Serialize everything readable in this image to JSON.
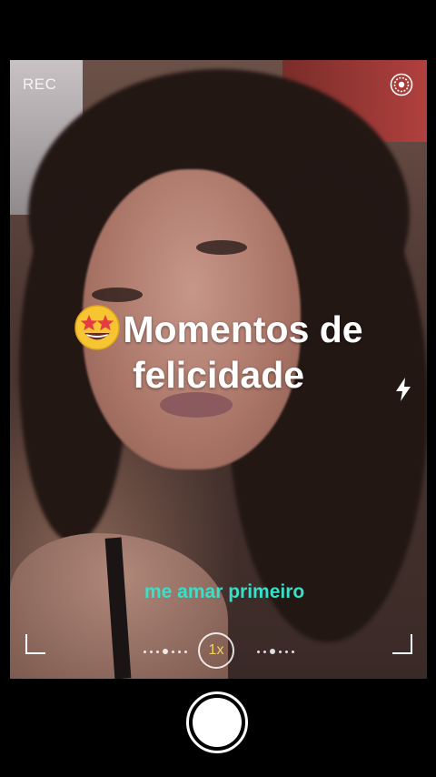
{
  "camera": {
    "rec_label": "REC",
    "zoom_label": "1x"
  },
  "overlay": {
    "caption_emoji": "star-struck-emoji",
    "caption_line1": "Momentos de",
    "caption_line2": "felicidade",
    "lyric": "me amar primeiro"
  },
  "colors": {
    "lyric": "#37e0c8",
    "zoom_text": "#f3d35a",
    "background": "#000000"
  },
  "icons": {
    "settings": "target-rings-icon",
    "flash": "lightning-icon",
    "emoji": "star-struck-emoji"
  }
}
